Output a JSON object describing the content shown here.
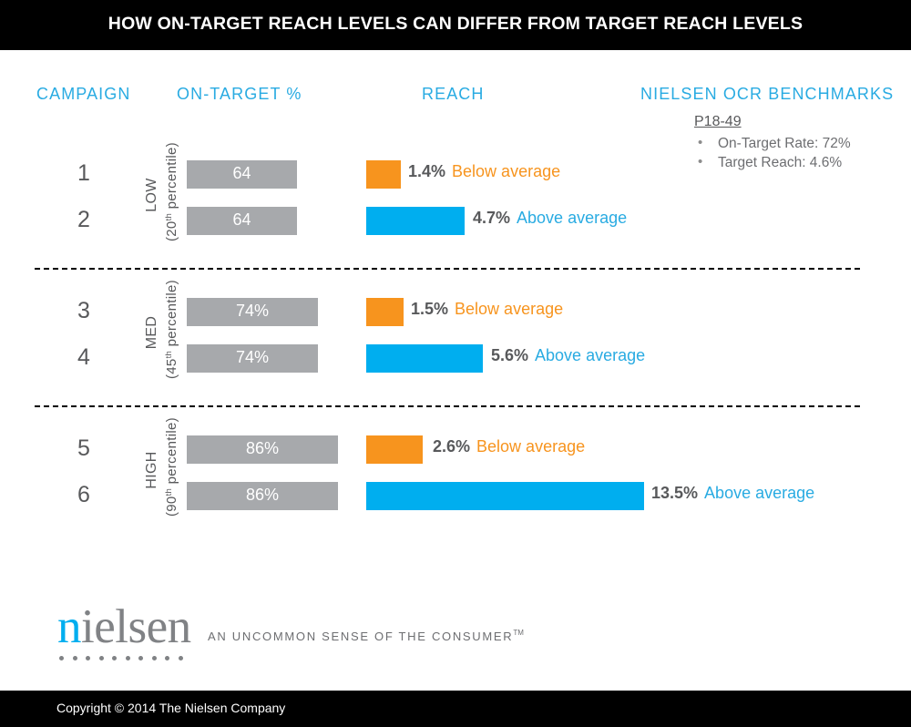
{
  "title": "HOW ON-TARGET REACH LEVELS CAN DIFFER FROM TARGET REACH LEVELS",
  "headers": {
    "campaign": "CAMPAIGN",
    "on_target": "ON-TARGET %",
    "reach": "REACH",
    "benchmarks": "NIELSEN OCR BENCHMARKS"
  },
  "benchmarks": {
    "title": "P18-49",
    "bullet_glyph": "•",
    "items": [
      "On-Target Rate: 72%",
      "Target Reach: 4.6%"
    ]
  },
  "colors": {
    "accent_blue": "#29abe2",
    "bar_blue": "#00aeef",
    "bar_orange": "#f7941e",
    "bar_grey": "#a7a9ac",
    "text_grey": "#58595b",
    "black": "#000000"
  },
  "groups": [
    {
      "id": "low",
      "level": "LOW",
      "percentile": "(20",
      "percentile_sup": "th",
      "percentile_end": " percentile)",
      "rows": [
        {
          "campaign": "1",
          "on_target_label": "64",
          "on_target_value": 64,
          "reach_pct": "1.4%",
          "reach_value": 1.4,
          "reach_desc": "Below average",
          "reach_type": "below"
        },
        {
          "campaign": "2",
          "on_target_label": "64",
          "on_target_value": 64,
          "reach_pct": "4.7%",
          "reach_value": 4.7,
          "reach_desc": "Above average",
          "reach_type": "above"
        }
      ]
    },
    {
      "id": "med",
      "level": "MED",
      "percentile": "(45",
      "percentile_sup": "th",
      "percentile_end": " percentile)",
      "rows": [
        {
          "campaign": "3",
          "on_target_label": "74%",
          "on_target_value": 74,
          "reach_pct": "1.5%",
          "reach_value": 1.5,
          "reach_desc": "Below average",
          "reach_type": "below"
        },
        {
          "campaign": "4",
          "on_target_label": "74%",
          "on_target_value": 74,
          "reach_pct": "5.6%",
          "reach_value": 5.6,
          "reach_desc": "Above average",
          "reach_type": "above"
        }
      ]
    },
    {
      "id": "high",
      "level": "HIGH",
      "percentile": "(90",
      "percentile_sup": "th",
      "percentile_end": " percentile)",
      "rows": [
        {
          "campaign": "5",
          "on_target_label": "86%",
          "on_target_value": 86,
          "reach_pct": "2.6%",
          "reach_value": 2.6,
          "reach_desc": "Below average",
          "reach_type": "below"
        },
        {
          "campaign": "6",
          "on_target_label": "86%",
          "on_target_value": 86,
          "reach_pct": "13.5%",
          "reach_value": 13.5,
          "reach_desc": "Above average",
          "reach_type": "above"
        }
      ]
    }
  ],
  "chart_data": {
    "type": "bar",
    "title": "HOW ON-TARGET REACH LEVELS CAN DIFFER FROM TARGET REACH LEVELS",
    "xlabel": "",
    "ylabel": "Campaign",
    "categories": [
      "1",
      "2",
      "3",
      "4",
      "5",
      "6"
    ],
    "series": [
      {
        "name": "ON-TARGET %",
        "values": [
          64,
          64,
          74,
          74,
          86,
          86
        ],
        "color": "#a7a9ac",
        "labels": [
          "64",
          "64",
          "74%",
          "74%",
          "86%",
          "86%"
        ]
      },
      {
        "name": "REACH",
        "values": [
          1.4,
          4.7,
          1.5,
          5.6,
          2.6,
          13.5
        ],
        "colors": [
          "#f7941e",
          "#00aeef",
          "#f7941e",
          "#00aeef",
          "#f7941e",
          "#00aeef"
        ],
        "labels": [
          "1.4%",
          "4.7%",
          "1.5%",
          "5.6%",
          "2.6%",
          "13.5%"
        ]
      }
    ],
    "annotations": [
      "1: Below average",
      "2: Above average",
      "3: Below average",
      "4: Above average",
      "5: Below average",
      "6: Above average"
    ],
    "groups": [
      {
        "label": "LOW (20th percentile)",
        "campaigns": [
          "1",
          "2"
        ]
      },
      {
        "label": "MED (45th percentile)",
        "campaigns": [
          "3",
          "4"
        ]
      },
      {
        "label": "HIGH (90th percentile)",
        "campaigns": [
          "5",
          "6"
        ]
      }
    ],
    "benchmarks": {
      "P18-49": {
        "On-Target Rate": "72%",
        "Target Reach": "4.6%"
      }
    },
    "grid": false,
    "legend": "none"
  },
  "logo": {
    "first_letter": "n",
    "rest": "ielsen",
    "tagline": "AN UNCOMMON SENSE OF THE CONSUMER",
    "tagline_sup": "TM"
  },
  "footer": {
    "copyright": "Copyright © 2014 The Nielsen Company"
  }
}
